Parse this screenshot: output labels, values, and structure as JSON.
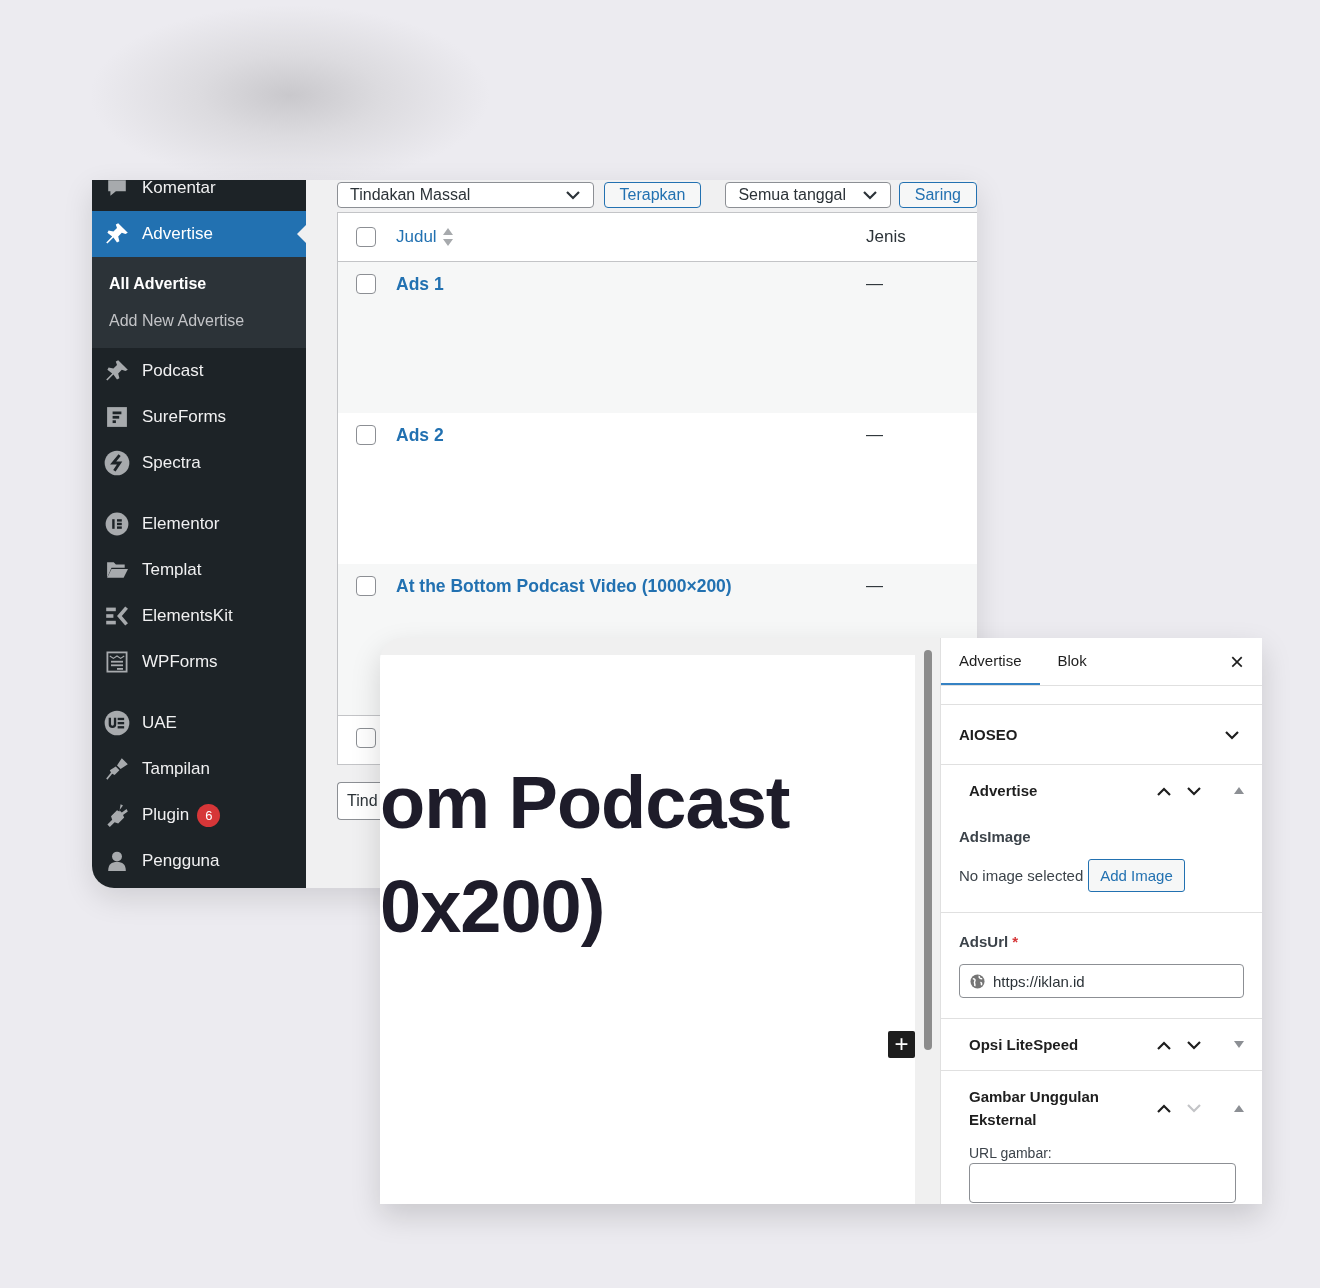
{
  "admin_window": {
    "sidebar": {
      "groups": [
        {
          "items": [
            {
              "label": "Komentar",
              "selected": false
            },
            {
              "label": "Advertise",
              "selected": true,
              "children": [
                {
                  "label": "All Advertise",
                  "selected": true
                },
                {
                  "label": "Add New Advertise",
                  "selected": false
                }
              ]
            },
            {
              "label": "Podcast",
              "selected": false
            },
            {
              "label": "SureForms",
              "selected": false
            },
            {
              "label": "Spectra",
              "selected": false
            }
          ]
        },
        {
          "items": [
            {
              "label": "Elementor",
              "selected": false
            },
            {
              "label": "Templat",
              "selected": false
            },
            {
              "label": "ElementsKit",
              "selected": false
            },
            {
              "label": "WPForms",
              "selected": false
            }
          ]
        },
        {
          "items": [
            {
              "label": "UAE",
              "selected": false
            },
            {
              "label": "Tampilan",
              "selected": false
            },
            {
              "label": "Plugin",
              "selected": false,
              "badge": "6"
            },
            {
              "label": "Pengguna",
              "selected": false
            }
          ]
        }
      ]
    },
    "toolbar": {
      "bulk_action": "Tindakan Massal",
      "apply": "Terapkan",
      "date_filter": "Semua tanggal",
      "filter": "Saring"
    },
    "table": {
      "columns": [
        {
          "label": "Judul",
          "sortable": true
        },
        {
          "label": "Jenis",
          "sortable": false
        }
      ],
      "header_checked": false,
      "rows": [
        {
          "title": "Ads 1",
          "type": "—",
          "checked": false
        },
        {
          "title": "Ads 2",
          "type": "—",
          "checked": false
        },
        {
          "title": "At the Bottom Podcast Video (1000×200)",
          "type": "—",
          "checked": false
        },
        {
          "checked": false
        }
      ]
    },
    "footer": {
      "bulk_action": "Tind"
    }
  },
  "editor_window": {
    "canvas": {
      "heading_lines": [
        "om Podcast",
        "0x200)"
      ],
      "inserter": "+"
    },
    "tabs": [
      {
        "label": "Advertise",
        "selected": true
      },
      {
        "label": "Blok",
        "selected": false
      }
    ],
    "close": "×",
    "panels": [
      {
        "kind": "toggle",
        "title": "AIOSEO",
        "expanded": false
      },
      {
        "kind": "metabox",
        "title": "Advertise",
        "expanded": true,
        "down_disabled": false,
        "fields": [
          {
            "kind": "image",
            "label": "AdsImage",
            "status": "No image selected",
            "button": "Add Image"
          },
          {
            "kind": "url",
            "label": "AdsUrl",
            "required_mark": "*",
            "value": "https://iklan.id"
          }
        ]
      },
      {
        "kind": "metabox",
        "title": "Opsi LiteSpeed",
        "expanded": false,
        "down_disabled": false
      },
      {
        "kind": "metabox",
        "title": "Gambar Unggulan Eksternal",
        "expanded": true,
        "down_disabled": true,
        "fields": [
          {
            "kind": "text",
            "label": "URL gambar:"
          }
        ]
      }
    ]
  }
}
